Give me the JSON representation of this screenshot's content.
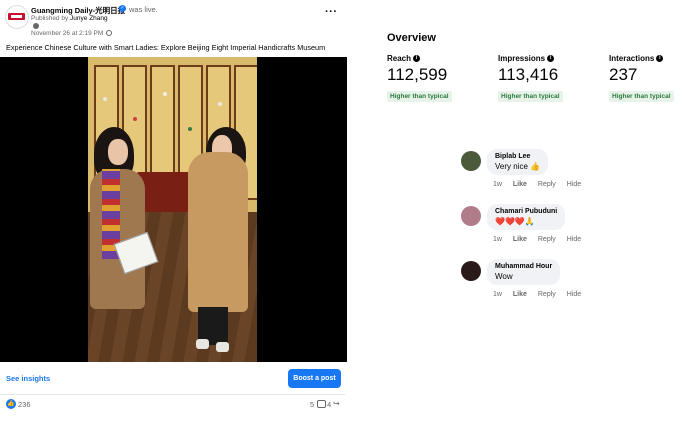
{
  "post": {
    "page_name": "Guangming Daily-光明日报",
    "status": "was live.",
    "published_by_prefix": "Published by",
    "published_by_name": "Junye Zhang",
    "date": "November 26 at 2:19 PM ·",
    "more_label": "···",
    "caption": "Experience Chinese Culture with Smart Ladies: Explore Beijing Eight Imperial Handicrafts Museum",
    "see_insights": "See insights",
    "boost_button": "Boost a post",
    "reactions_count": "236",
    "comments_count": "5",
    "shares_count": "4",
    "icons": [
      "verified-badge-icon",
      "info-icon",
      "globe-icon",
      "more-icon",
      "like-icon",
      "comment-icon",
      "share-icon"
    ]
  },
  "overview": {
    "title": "Overview",
    "metrics": [
      {
        "label": "Reach",
        "value": "112,599",
        "badge": "Higher than typical"
      },
      {
        "label": "Impressions",
        "value": "113,416",
        "badge": "Higher than typical"
      },
      {
        "label": "Interactions",
        "value": "237",
        "badge": "Higher than typical"
      }
    ]
  },
  "comments": [
    {
      "author": "Biplab Lee",
      "text": "Very nice 👍",
      "time": "1w",
      "like": "Like",
      "reply": "Reply",
      "hide": "Hide",
      "avatar_color": "#4a5a3a"
    },
    {
      "author": "Chamari Pubuduni",
      "text": "❤️❤️❤️🙏",
      "time": "1w",
      "like": "Like",
      "reply": "Reply",
      "hide": "Hide",
      "avatar_color": "#b07c8a"
    },
    {
      "author": "Muhammad Hour",
      "text": "Wow",
      "time": "1w",
      "like": "Like",
      "reply": "Reply",
      "hide": "Hide",
      "avatar_color": "#2a1a18"
    }
  ],
  "colors": {
    "accent": "#1877f2",
    "badge_bg": "#e7f3e8",
    "badge_text": "#2b7a3b"
  }
}
